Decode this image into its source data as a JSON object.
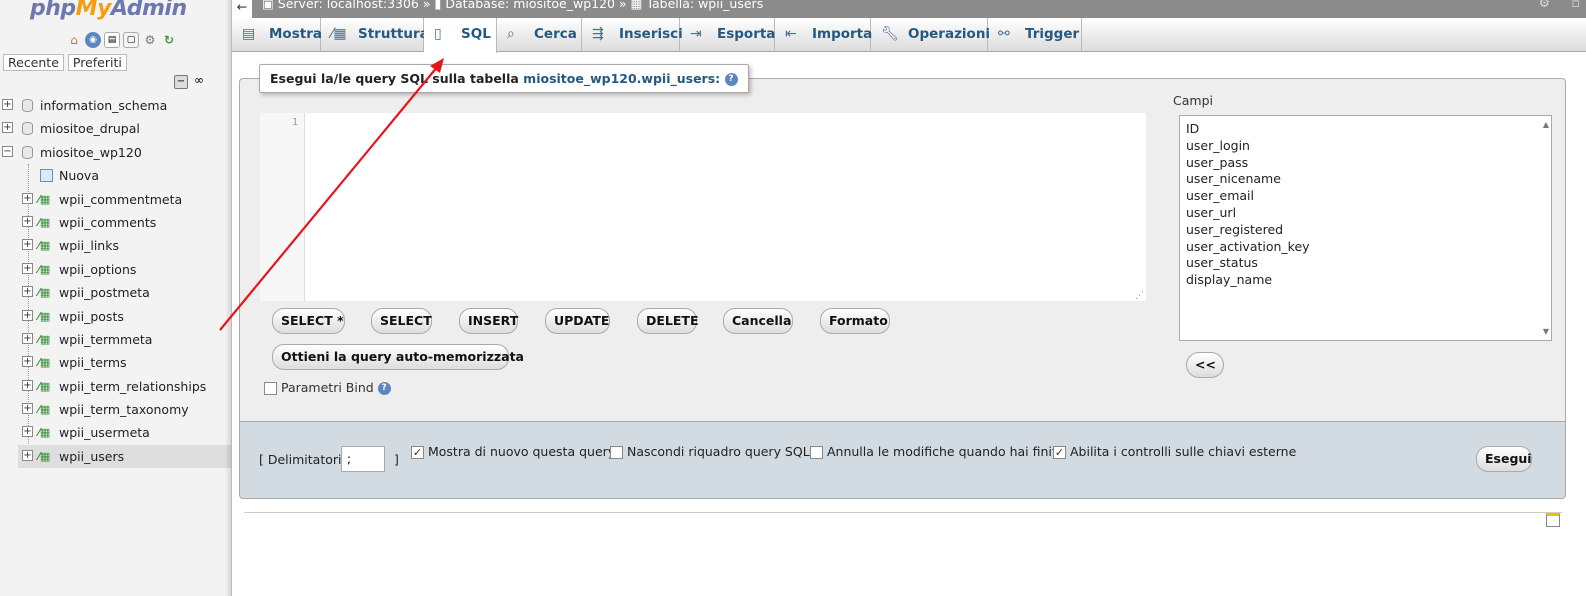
{
  "nav": {
    "logo_php": "php",
    "logo_my": "My",
    "logo_admin": "Admin",
    "tabs": [
      "Recente",
      "Preferiti"
    ],
    "databases": [
      {
        "name": "information_schema",
        "expanded": false
      },
      {
        "name": "miositoe_drupal",
        "expanded": false
      },
      {
        "name": "miositoe_wp120",
        "expanded": true
      }
    ],
    "new_item": "Nuova",
    "tables": [
      "wpii_commentmeta",
      "wpii_comments",
      "wpii_links",
      "wpii_options",
      "wpii_postmeta",
      "wpii_posts",
      "wpii_termmeta",
      "wpii_terms",
      "wpii_term_relationships",
      "wpii_term_taxonomy",
      "wpii_usermeta",
      "wpii_users"
    ],
    "selected_table": "wpii_users"
  },
  "breadcrumb": {
    "server": "Server: localhost:3306",
    "sep": "»",
    "database": "Database: miositoe_wp120",
    "table": "Tabella: wpii_users"
  },
  "menu": {
    "tabs": [
      {
        "label": "Mostra",
        "icon": "browse-icon"
      },
      {
        "label": "Struttura",
        "icon": "structure-icon"
      },
      {
        "label": "SQL",
        "icon": "sql-icon",
        "active": true
      },
      {
        "label": "Cerca",
        "icon": "search-icon"
      },
      {
        "label": "Inserisci",
        "icon": "insert-icon"
      },
      {
        "label": "Esporta",
        "icon": "export-icon"
      },
      {
        "label": "Importa",
        "icon": "import-icon"
      },
      {
        "label": "Operazioni",
        "icon": "wrench-icon"
      },
      {
        "label": "Trigger",
        "icon": "trigger-icon"
      }
    ]
  },
  "sql": {
    "legend_prefix": "Esegui la/le query SQL sulla tabella",
    "legend_table": "miositoe_wp120.wpii_users:",
    "help": "?",
    "line_number": "1",
    "query_text": "",
    "buttons": [
      "SELECT *",
      "SELECT",
      "INSERT",
      "UPDATE",
      "DELETE",
      "Cancella",
      "Formato"
    ],
    "auto_query_button": "Ottieni la query auto-memorizzata",
    "bind_label": "Parametri Bind",
    "bind_checked": false
  },
  "fields": {
    "label": "Campi",
    "items": [
      "ID",
      "user_login",
      "user_pass",
      "user_nicename",
      "user_email",
      "user_url",
      "user_registered",
      "user_activation_key",
      "user_status",
      "display_name"
    ],
    "insert_button": "<<"
  },
  "footer": {
    "delimiter_label": "[ Delimitatori",
    "delimiter_value": ";",
    "delimiter_close": "]",
    "options": [
      {
        "label": "Mostra di nuovo questa query",
        "checked": true
      },
      {
        "label": "Nascondi riquadro query SQL",
        "checked": false
      },
      {
        "label": "Annulla le modifiche quando hai finito",
        "checked": false
      },
      {
        "label": "Abilita i controlli sulle chiavi esterne",
        "checked": true
      }
    ],
    "go_button": "Esegui"
  },
  "colors": {
    "accent": "#235a81",
    "footer_bg": "#d2dbe1",
    "annotation_arrow": "#e8141c"
  }
}
